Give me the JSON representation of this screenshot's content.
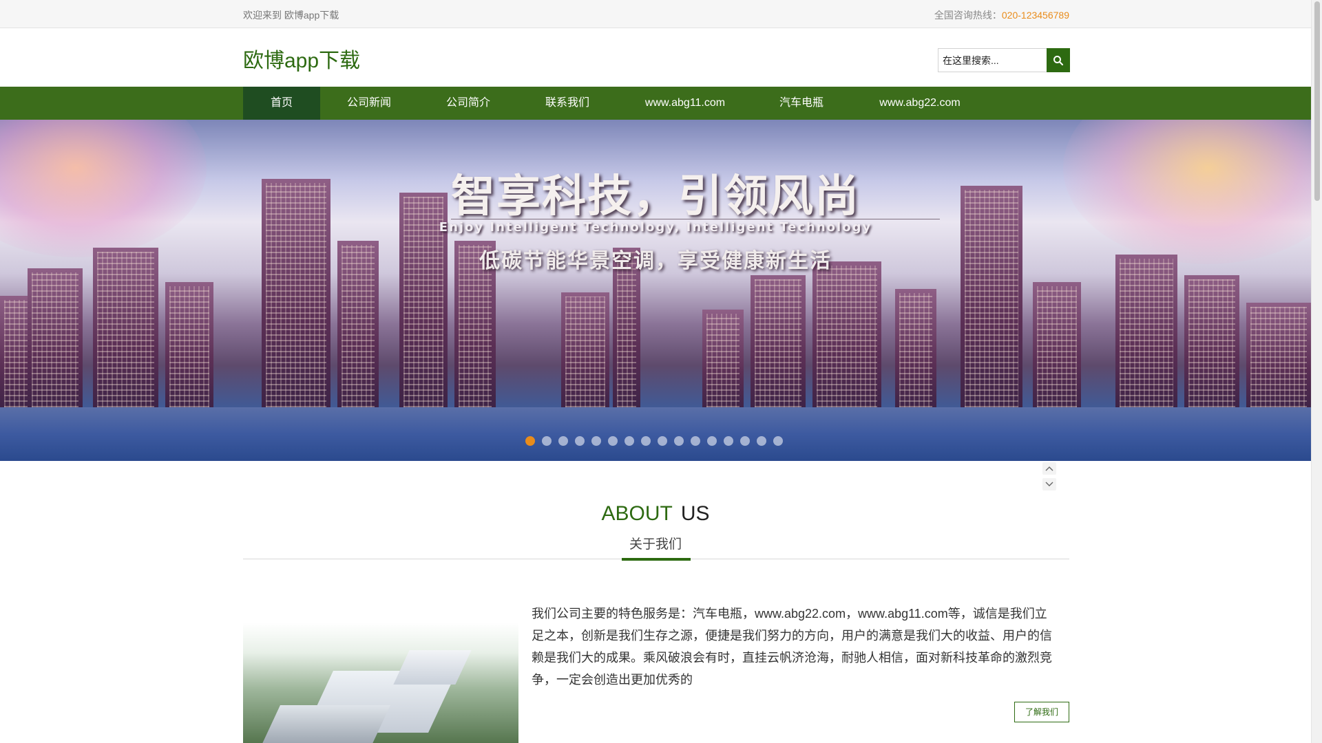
{
  "topbar": {
    "welcome": "欢迎来到 欧博app下载",
    "hotline_label": "全国咨询热线：",
    "hotline_number": "020-123456789"
  },
  "header": {
    "logo": "欧博app下载",
    "search_placeholder": "在这里搜索...",
    "search_icon": "search-icon"
  },
  "nav": {
    "items": [
      {
        "label": "首页",
        "active": true
      },
      {
        "label": "公司新闻",
        "active": false
      },
      {
        "label": "公司简介",
        "active": false
      },
      {
        "label": "联系我们",
        "active": false
      },
      {
        "label": "www.abg11.com",
        "active": false
      },
      {
        "label": "汽车电瓶",
        "active": false
      },
      {
        "label": "www.abg22.com",
        "active": false
      }
    ]
  },
  "banner": {
    "headline": "智享科技，引领风尚",
    "subline_en": "Enjoy Intelligent Technology, Intelligent Technology",
    "subline_cn": "低碳节能华景空调，享受健康新生活",
    "slide_count": 16,
    "active_slide": 1
  },
  "about": {
    "title_en_1": "ABOUT",
    "title_en_2": "US",
    "title_cn": "关于我们",
    "body": "我们公司主要的特色服务是：汽车电瓶，www.abg22.com，www.abg11.com等，诚信是我们立足之本，创新是我们生存之源，便捷是我们努力的方向，用户的满意是我们大的收益、用户的信赖是我们大的成果。乘风破浪会有时，直挂云帆济沧海，耐驰人相信，面对新科技革命的激烈竞争，一定会创造出更加优秀的",
    "button_label": "了解我们"
  },
  "colors": {
    "brand_green": "#2d6a11",
    "nav_green": "#3c6d1b",
    "nav_active": "#1f4d21",
    "accent_orange": "#e98c1b"
  }
}
